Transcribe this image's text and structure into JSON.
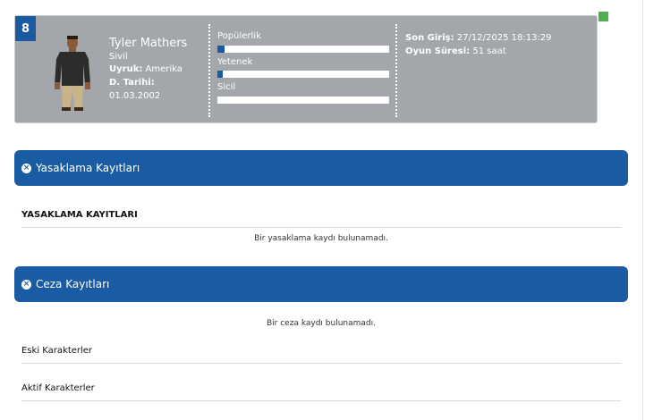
{
  "character": {
    "level": "8",
    "name": "Tyler Mathers",
    "job": "Sivil",
    "nationality_label": "Uyruk:",
    "nationality": "Amerika",
    "dob_label": "D. Tarihi:",
    "dob": "01.03.2002",
    "stats": [
      {
        "label": "Popülerlik",
        "fill": 0.04
      },
      {
        "label": "Yetenek",
        "fill": 0.03
      },
      {
        "label": "Sicil",
        "fill": 0.0
      }
    ],
    "last_login_label": "Son Giriş:",
    "last_login": "27/12/2025 18:13:29",
    "play_time_label": "Oyun Süresi:",
    "play_time": "51 saat",
    "online_color": "#4caf50"
  },
  "bans": {
    "header": "Yasaklama Kayıtları",
    "table_title": "YASAKLAMA KAYITLARI",
    "empty": "Bir yasaklama kaydı bulunamadı."
  },
  "penalties": {
    "header": "Ceza Kayıtları",
    "empty": "Bir ceza kaydı bulunamadı."
  },
  "old_characters": {
    "title": "Eski Karakterler"
  },
  "active_characters": {
    "title": "Aktif Karakterler"
  },
  "colors": {
    "accent": "#1a5ca3",
    "card_bg": "#a3a6ab"
  }
}
